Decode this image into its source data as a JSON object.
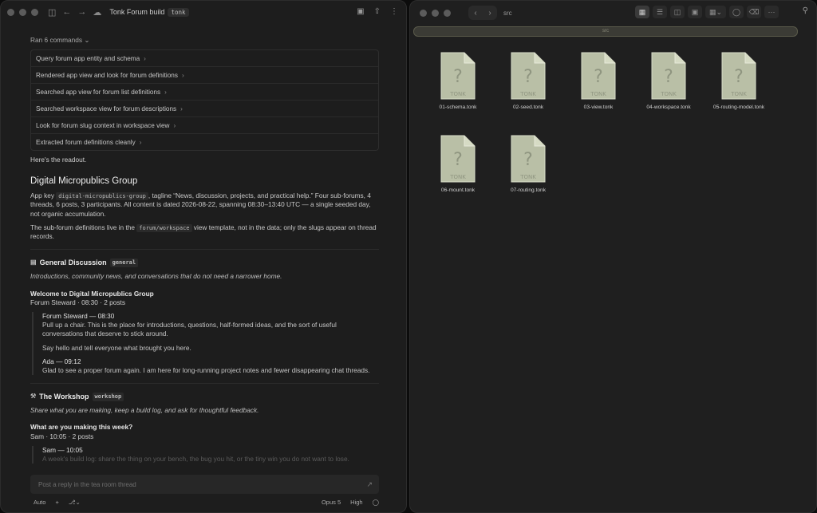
{
  "left_window": {
    "title": "Tonk Forum build",
    "title_tag": "tonk",
    "ran_label": "Ran 6 commands",
    "commands": [
      "Query forum app entity and schema",
      "Rendered app view and look for forum definitions",
      "Searched app view for forum list definitions",
      "Searched workspace view for forum descriptions",
      "Look for forum slug context in workspace view",
      "Extracted forum definitions cleanly"
    ],
    "readout": "Here's the readout.",
    "heading": "Digital Micropublics Group",
    "summary": {
      "p1_a": "App key ",
      "p1_code": "digital-micropublics-group",
      "p1_b": ", tagline “News, discussion, projects, and practical help.” Four sub-forums, 4 threads, 6 posts, 3 participants. All content is dated 2026-08-22, spanning 08:30–13:40 UTC — a single seeded day, not organic accumulation.",
      "p2_a": "The sub-forum definitions live in the ",
      "p2_code": "forum/workspace",
      "p2_b": " view template, not in the data; only the slugs appear on thread records."
    },
    "forums": [
      {
        "icon": "▤",
        "name": "General Discussion",
        "slug": "general",
        "tagline": "Introductions, community news, and conversations that do not need a narrower home.",
        "thread_title": "Welcome to Digital Micropublics Group",
        "thread_meta": "Forum Steward · 08:30 · 2 posts",
        "posts": [
          {
            "author": "Forum Steward — 08:30",
            "body": [
              "Pull up a chair. This is the place for introductions, questions, half-formed ideas, and the sort of useful conversations that deserve to stick around.",
              "Say hello and tell everyone what brought you here."
            ]
          },
          {
            "author": "Ada — 09:12",
            "body": [
              "Glad to see a proper forum again. I am here for long-running project notes and fewer disappearing chat threads."
            ]
          }
        ]
      },
      {
        "icon": "⚒",
        "name": "The Workshop",
        "slug": "workshop",
        "tagline": "Share what you are making, keep a build log, and ask for thoughtful feedback.",
        "thread_title": "What are you making this week?",
        "thread_meta": "Sam · 10:05 · 2 posts",
        "posts": [
          {
            "author": "Sam — 10:05",
            "body": [
              "A week's build log: share the thing on your bench, the bug you hit, or the tiny win you do not want to lose."
            ]
          }
        ]
      }
    ],
    "composer_placeholder": "Post a reply in the tea room thread",
    "footer": {
      "mode": "Auto",
      "model": "Opus 5",
      "effort": "High"
    }
  },
  "right_window": {
    "folder": "src",
    "path_label": "src",
    "files": [
      "01-schema.tonk",
      "02-seed.tonk",
      "03-view.tonk",
      "04-workspace.tonk",
      "05-routing-model.tonk",
      "06-mount.tonk",
      "07-routing.tonk"
    ],
    "file_badge": "TONK",
    "file_glyph": "?"
  }
}
